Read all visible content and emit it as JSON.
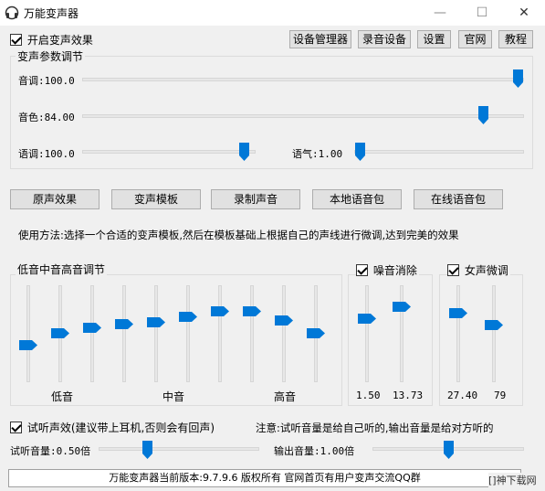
{
  "app": {
    "title": "万能变声器"
  },
  "window_buttons": {
    "minimize": "—",
    "maximize": "☐",
    "close": "✕"
  },
  "top": {
    "enable_label": "开启变声效果",
    "enable_checked": true,
    "buttons": [
      "设备管理器",
      "录音设备",
      "设置",
      "官网",
      "教程"
    ]
  },
  "params": {
    "legend": "变声参数调节",
    "pitch": {
      "label": "音调:100.0",
      "value": 100.0
    },
    "timbre": {
      "label": "音色:84.00",
      "value": 84.0
    },
    "speed": {
      "label": "语调:100.0",
      "value": 100.0
    },
    "tone": {
      "label": "语气:1.00",
      "value": 1.0
    }
  },
  "actions": [
    "原声效果",
    "变声模板",
    "录制声音",
    "本地语音包",
    "在线语音包"
  ],
  "usage": "使用方法:选择一个合适的变声模板,然后在模板基础上根据自己的声线进行微调,达到完美的效果",
  "eq": {
    "legend": "低音中音高音调节",
    "low_label": "低音",
    "mid_label": "中音",
    "high_label": "高音",
    "levels": [
      0.36,
      0.5,
      0.56,
      0.61,
      0.63,
      0.69,
      0.76,
      0.76,
      0.65,
      0.5
    ]
  },
  "noise": {
    "label": "噪音消除",
    "checked": true,
    "values": [
      "1.50",
      "13.73"
    ],
    "levels": [
      0.67,
      0.81
    ]
  },
  "female": {
    "label": "女声微调",
    "checked": true,
    "values": [
      "27.40",
      "79"
    ],
    "levels": [
      0.73,
      0.6
    ]
  },
  "monitor": {
    "label": "试听声效(建议带上耳机,否则会有回声)",
    "checked": true,
    "note": "注意:试听音量是给自己听的,输出音量是给对方听的",
    "listen_volume": {
      "label": "试听音量:0.50倍",
      "value": 0.5
    },
    "output_volume": {
      "label": "输出音量:1.00倍",
      "value": 1.0
    }
  },
  "status": "万能变声器当前版本:9.7.9.6  版权所有  官网首页有用户变声交流QQ群",
  "watermark": "[]神下载网"
}
